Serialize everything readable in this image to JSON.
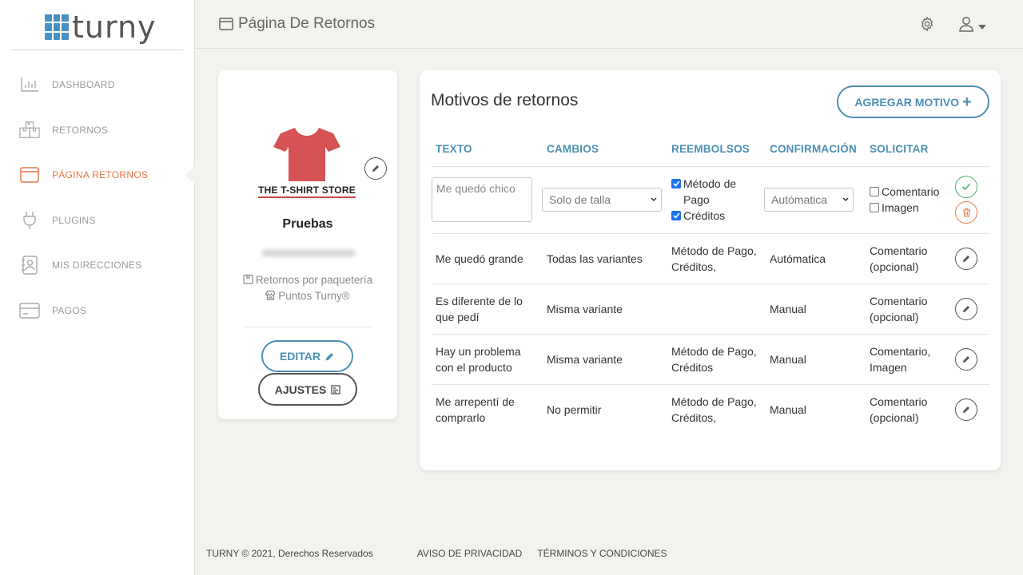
{
  "brand": {
    "name": "turny"
  },
  "sidebar": {
    "items": [
      {
        "label": "DASHBOARD",
        "icon": "bar-chart-icon",
        "active": false
      },
      {
        "label": "RETORNOS",
        "icon": "boxes-icon",
        "active": false
      },
      {
        "label": "PÁGINA RETORNOS",
        "icon": "browser-window-icon",
        "active": true
      },
      {
        "label": "PLUGINS",
        "icon": "plug-icon",
        "active": false
      },
      {
        "label": "MIS DIRECCIONES",
        "icon": "address-book-icon",
        "active": false
      },
      {
        "label": "PAGOS",
        "icon": "credit-card-icon",
        "active": false
      }
    ]
  },
  "header": {
    "title": "Página De Retornos"
  },
  "store": {
    "logo_text": "THE T-SHIRT STORE",
    "name": "Pruebas",
    "option_1": "Retornos por paquetería",
    "option_2": "Puntos Turny®",
    "edit_label": "EDITAR",
    "settings_label": "AJUSTES"
  },
  "panel": {
    "title": "Motivos de retornos",
    "add_label": "AGREGAR MOTIVO",
    "columns": [
      "TEXTO",
      "CAMBIOS",
      "REEMBOLSOS",
      "CONFIRMACIÓN",
      "SOLICITAR"
    ],
    "edit_row": {
      "text_placeholder": "Me quedó chico",
      "cambios_value": "Solo de talla",
      "reembolso_options": [
        {
          "label": "Método de Pago",
          "checked": true
        },
        {
          "label": "Créditos",
          "checked": true
        }
      ],
      "confirmacion_value": "Autómatica",
      "solicitar_options": [
        {
          "label": "Comentario",
          "checked": false
        },
        {
          "label": "Imagen",
          "checked": false
        }
      ]
    },
    "rows": [
      {
        "texto": "Me quedó grande",
        "cambios": "Todas las variantes",
        "reembolsos": "Método de Pago, Créditos,",
        "confirmacion": "Autómatica",
        "solicitar": "Comentario (opcional)"
      },
      {
        "texto": "Es diferente de lo que pedí",
        "cambios": "Misma variante",
        "reembolsos": "",
        "confirmacion": "Manual",
        "solicitar": "Comentario (opcional)"
      },
      {
        "texto": "Hay un problema con el producto",
        "cambios": "Misma variante",
        "reembolsos": "Método de Pago, Créditos",
        "confirmacion": "Manual",
        "solicitar": "Comentario, Imagen"
      },
      {
        "texto": "Me arrepentí de comprarlo",
        "cambios": "No permitir",
        "reembolsos": "Método de Pago, Créditos,",
        "confirmacion": "Manual",
        "solicitar": "Comentario (opcional)"
      }
    ]
  },
  "footer": {
    "copyright": "TURNY © 2021, Derechos Reservados",
    "privacy": "AVISO DE PRIVACIDAD",
    "terms": "TÉRMINOS Y CONDICIONES"
  },
  "colors": {
    "accent_blue": "#4d8fb5",
    "accent_orange": "#e8774a",
    "success_green": "#4caf70",
    "shirt_red": "#d65353"
  }
}
